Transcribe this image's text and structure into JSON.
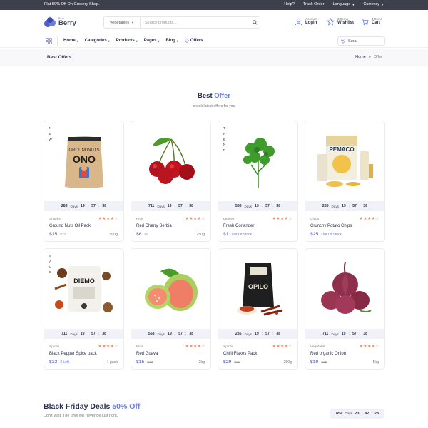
{
  "topbar": {
    "promo": "Flat 50% Off On Grocery Shop.",
    "help": "Help?",
    "track": "Track Order",
    "language": "Language",
    "currency": "Currency"
  },
  "header": {
    "logo_small": "Blue",
    "logo_big": "Berry",
    "search_category": "Vegetables",
    "search_placeholder": "Search products...",
    "account_l1": "Account",
    "account_l2": "Login",
    "wishlist_l1": "3 Items",
    "wishlist_l2": "Wishlist",
    "cart_l1": "4 Items",
    "cart_l2": "Cart"
  },
  "nav": {
    "items": [
      "Home",
      "Categories",
      "Products",
      "Pages",
      "Blog",
      "Offers"
    ],
    "location": "Surat"
  },
  "breadcrumb": {
    "title": "Best Offers",
    "home": "Home",
    "sep": "»",
    "current": "Offer"
  },
  "section": {
    "title_main": "Best",
    "title_accent": "Offer",
    "subtitle": "check latest offers for you"
  },
  "colors": {
    "accent": "#6c7fd8",
    "star": "#f5885f",
    "topbar": "#3d3f4a"
  },
  "products": [
    {
      "badge": [
        "N",
        "E",
        "W"
      ],
      "days": "285",
      "hh": "19",
      "mm": "57",
      "ss": "38",
      "days_label": "Days",
      "category": "Snacks",
      "stars": 4,
      "name": "Ground Nuts Oil Pack",
      "price": "$15",
      "old": "$22",
      "note": "",
      "weight": "500g",
      "image": "ono-pouch"
    },
    {
      "badge": [],
      "days": "711",
      "hh": "19",
      "mm": "57",
      "ss": "38",
      "days_label": "Days",
      "category": "Fruit",
      "stars": 4,
      "name": "Red Cherry Serbia",
      "price": "$6",
      "old": "$8",
      "note": "",
      "weight": "250g",
      "image": "cherries"
    },
    {
      "badge": [
        "T",
        "R",
        "E",
        "N",
        "D"
      ],
      "days": "558",
      "hh": "19",
      "mm": "57",
      "ss": "38",
      "days_label": "Days",
      "category": "Leaves",
      "stars": 4,
      "name": "Fresh Coriander",
      "price": "$1",
      "old": "",
      "note": "Out Of Stock",
      "weight": "",
      "image": "coriander"
    },
    {
      "badge": [],
      "days": "285",
      "hh": "19",
      "mm": "57",
      "ss": "38",
      "days_label": "Days",
      "category": "Chips",
      "stars": 4,
      "name": "Crunchy Potato Chips",
      "price": "$25",
      "old": "",
      "note": "Out Of Stock",
      "weight": "",
      "image": "pemaco-chips"
    },
    {
      "badge": [
        "S",
        "A",
        "L",
        "E"
      ],
      "days": "711",
      "hh": "19",
      "mm": "57",
      "ss": "38",
      "days_label": "Days",
      "category": "Spices",
      "stars": 4,
      "name": "Black Pepper Spice pack",
      "price": "$32",
      "old": "",
      "note": "2 Left",
      "weight": "1 pack",
      "image": "diemo-spice"
    },
    {
      "badge": [],
      "days": "558",
      "hh": "19",
      "mm": "57",
      "ss": "38",
      "days_label": "Days",
      "category": "Fruit",
      "stars": 4,
      "name": "Red Guava",
      "price": "$15",
      "old": "$17",
      "note": "",
      "weight": "2kg",
      "image": "guava"
    },
    {
      "badge": [],
      "days": "285",
      "hh": "19",
      "mm": "57",
      "ss": "38",
      "days_label": "Days",
      "category": "Spices",
      "stars": 4,
      "name": "Chilli Flakes Pack",
      "price": "$29",
      "old": "$31",
      "note": "",
      "weight": "250g",
      "image": "opilo-pack"
    },
    {
      "badge": [],
      "days": "711",
      "hh": "19",
      "mm": "57",
      "ss": "38",
      "days_label": "Days",
      "category": "Vegetable",
      "stars": 4,
      "name": "Red organic Onion",
      "price": "$10",
      "old": "$15",
      "note": "",
      "weight": "5kg",
      "image": "onions"
    }
  ],
  "friday": {
    "title_main": "Black Friday Deals",
    "title_accent": "50% Off",
    "subtitle": "Don't wait. The time will never be just right.",
    "days": "854",
    "days_label": "Days",
    "hh": "23",
    "mm": "42",
    "ss": "28"
  }
}
